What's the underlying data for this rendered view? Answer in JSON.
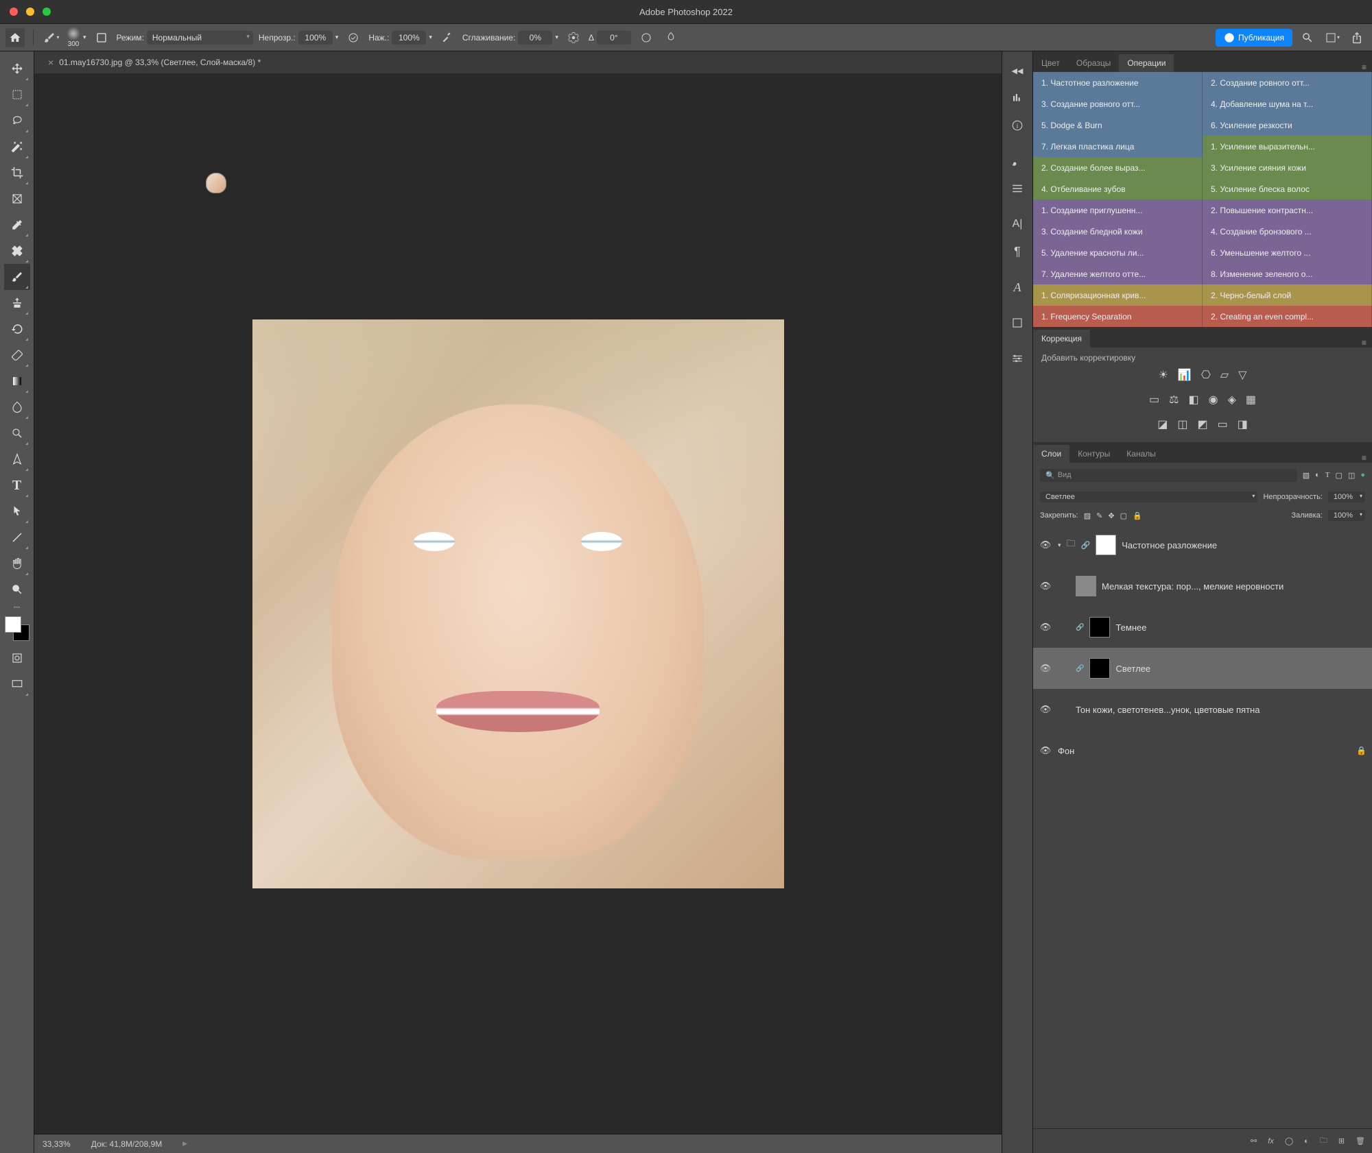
{
  "app": {
    "title": "Adobe Photoshop 2022"
  },
  "doctab": "01.may16730.jpg @ 33,3% (Светлее, Слой-маска/8) *",
  "optionbar": {
    "brush_size": "300",
    "mode_label": "Режим:",
    "mode_value": "Нормальный",
    "opacity_label": "Непрозр.:",
    "opacity_value": "100%",
    "flow_label": "Наж.:",
    "flow_value": "100%",
    "smooth_label": "Сглаживание:",
    "smooth_value": "0%",
    "angle_label": "Δ",
    "angle_value": "0°",
    "publish": "Публикация"
  },
  "panel_tabs": {
    "color": "Цвет",
    "swatches": "Образцы",
    "actions": "Операции"
  },
  "actions": [
    {
      "l": "1. Частотное разложение",
      "r": "2. Создание ровного отт...",
      "c": "blue"
    },
    {
      "l": "3. Создание ровного отт...",
      "r": "4. Добавление шума на т...",
      "c": "blue"
    },
    {
      "l": "5. Dodge & Burn",
      "r": "6. Усиление резкости",
      "c": "blue"
    },
    {
      "l": "7. Легкая пластика лица",
      "r": "1. Усиление выразительн...",
      "c": "blue",
      "rc": "green"
    },
    {
      "l": "2. Создание более выраз...",
      "r": "3. Усиление сияния кожи",
      "c": "green"
    },
    {
      "l": "4. Отбеливание зубов",
      "r": "5. Усиление блеска волос",
      "c": "green"
    },
    {
      "l": "1. Создание приглушенн...",
      "r": "2. Повышение контрастн...",
      "c": "purple"
    },
    {
      "l": "3. Создание бледной кожи",
      "r": "4. Создание бронзового ...",
      "c": "purple"
    },
    {
      "l": "5. Удаление красноты ли...",
      "r": "6. Уменьшение желтого ...",
      "c": "purple"
    },
    {
      "l": "7. Удаление желтого отте...",
      "r": "8. Изменение зеленого о...",
      "c": "purple"
    },
    {
      "l": "1. Соляризационная крив...",
      "r": "2. Черно-белый слой",
      "c": "olive"
    },
    {
      "l": "1. Frequency Separation",
      "r": "2. Creating an even compl...",
      "c": "red"
    }
  ],
  "adjustments": {
    "title": "Коррекция",
    "add": "Добавить корректировку"
  },
  "layers_panel": {
    "tabs": {
      "layers": "Слои",
      "paths": "Контуры",
      "channels": "Каналы"
    },
    "search": "Вид",
    "blend": "Светлее",
    "opacity_label": "Непрозрачность:",
    "opacity": "100%",
    "lock_label": "Закрепить:",
    "fill_label": "Заливка:",
    "fill": "100%"
  },
  "layers": [
    {
      "name": "Частотное разложение",
      "type": "group",
      "indent": 0,
      "open": true
    },
    {
      "name": "Мелкая текстура: пор..., мелкие неровности",
      "type": "layer",
      "indent": 1,
      "thumb": "gray"
    },
    {
      "name": "Темнее",
      "type": "layer",
      "indent": 1,
      "thumb": "face",
      "mask": "dark"
    },
    {
      "name": "Светлее",
      "type": "layer",
      "indent": 1,
      "thumb": "face",
      "mask": "dark",
      "sel": true
    },
    {
      "name": "Тон кожи, светотенев...унок, цветовые пятна",
      "type": "layer",
      "indent": 1,
      "thumb": "face"
    },
    {
      "name": "Фон",
      "type": "bg",
      "indent": 0,
      "thumb": "face",
      "locked": true
    }
  ],
  "status": {
    "zoom": "33,33%",
    "doc": "Док: 41,8M/208,9M"
  }
}
